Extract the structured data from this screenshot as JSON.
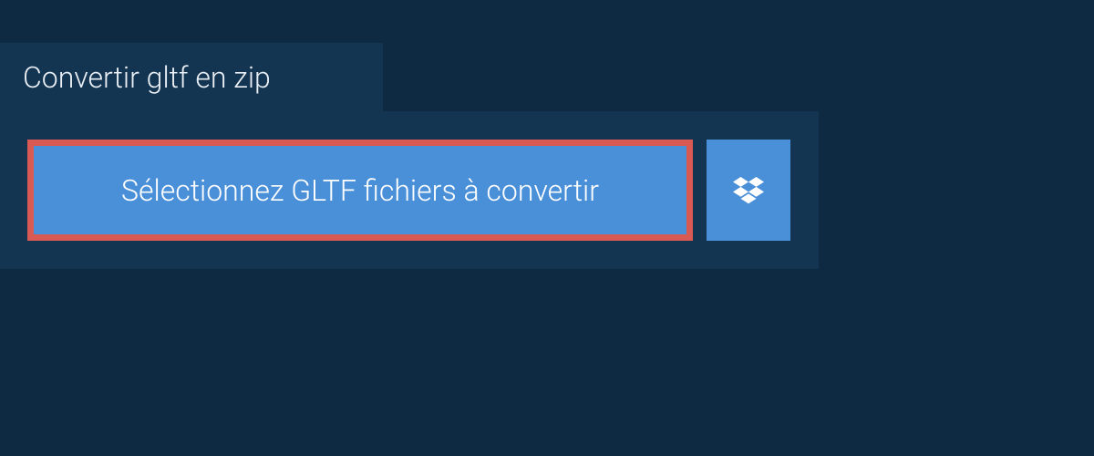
{
  "tab": {
    "title": "Convertir gltf en zip"
  },
  "actions": {
    "select_label": "Sélectionnez GLTF fichiers à convertir",
    "dropbox_icon": "dropbox-icon"
  },
  "colors": {
    "background_dark": "#0e2a43",
    "panel": "#133552",
    "button": "#4a90d9",
    "button_border": "#d85a52",
    "text_light": "#e8eef3",
    "text_white": "#ffffff"
  }
}
